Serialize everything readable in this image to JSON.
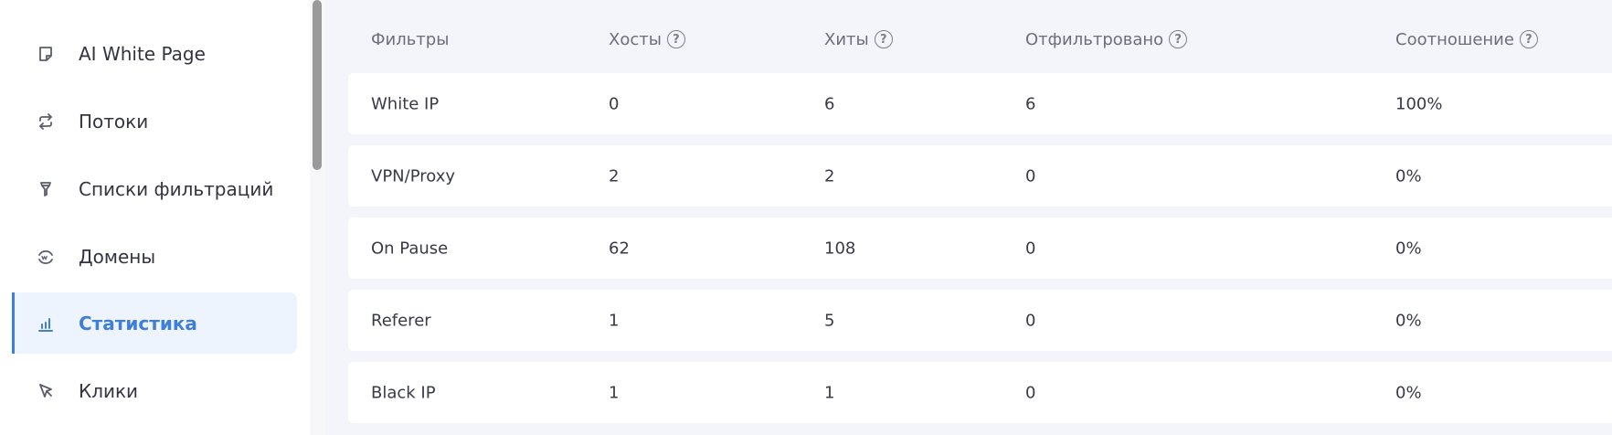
{
  "sidebar": {
    "items": [
      {
        "label": "AI White Page",
        "icon": "page-icon"
      },
      {
        "label": "Потоки",
        "icon": "repeat-icon"
      },
      {
        "label": "Списки фильтраций",
        "icon": "filter-icon"
      },
      {
        "label": "Домены",
        "icon": "domain-icon"
      },
      {
        "label": "Статистика",
        "icon": "bar-chart-icon",
        "active": true
      },
      {
        "label": "Клики",
        "icon": "cursor-icon"
      }
    ]
  },
  "table": {
    "headers": {
      "filters": "Фильтры",
      "hosts": "Хосты",
      "hits": "Хиты",
      "filtered": "Отфильтровано",
      "ratio": "Соотношение"
    },
    "help_glyph": "?",
    "rows": [
      {
        "filter": "White IP",
        "hosts": "0",
        "hits": "6",
        "filtered": "6",
        "ratio": "100%"
      },
      {
        "filter": "VPN/Proxy",
        "hosts": "2",
        "hits": "2",
        "filtered": "0",
        "ratio": "0%"
      },
      {
        "filter": "On Pause",
        "hosts": "62",
        "hits": "108",
        "filtered": "0",
        "ratio": "0%"
      },
      {
        "filter": "Referer",
        "hosts": "1",
        "hits": "5",
        "filtered": "0",
        "ratio": "0%"
      },
      {
        "filter": "Black IP",
        "hosts": "1",
        "hits": "1",
        "filtered": "0",
        "ratio": "0%"
      }
    ]
  },
  "colors": {
    "accent": "#3f7fd8",
    "active_bg": "#eef4fe",
    "page_bg": "#f4f5fa"
  }
}
